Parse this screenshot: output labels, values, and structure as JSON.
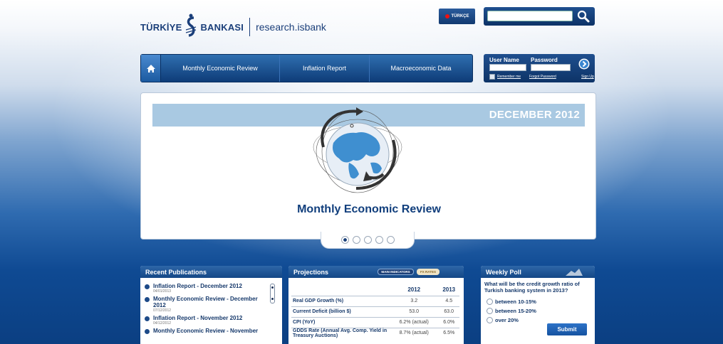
{
  "header": {
    "logo_left": "TÜRKİYE",
    "logo_right": "BANKASI",
    "logo_sub": "research.isbank",
    "lang_label": "TÜRKÇE",
    "search_placeholder": ""
  },
  "nav": {
    "items": [
      {
        "label": "Monthly Economic Review"
      },
      {
        "label": "Inflation Report"
      },
      {
        "label": "Macroeconomic Data"
      }
    ]
  },
  "login": {
    "user_label": "User Name",
    "password_label": "Password",
    "remember": "Remember me",
    "forgot": "Forgot Password",
    "signup": "Sign Up"
  },
  "slider": {
    "date": "DECEMBER 2012",
    "title": "Monthly Economic Review",
    "active_index": 0,
    "dot_count": 5
  },
  "publications": {
    "title": "Recent Publications",
    "items": [
      {
        "title": "Inflation Report - December 2012",
        "date": "04/01/2013"
      },
      {
        "title": "Monthly Economic Review - December 2012",
        "date": "07/12/2012"
      },
      {
        "title": "Inflation Report - November 2012",
        "date": "04/12/2012"
      },
      {
        "title": "Monthly Economic Review - November",
        "date": ""
      }
    ]
  },
  "projections": {
    "title": "Projections",
    "tab_main": "MAIN INDICATORS",
    "tab_rates": "FX RATES",
    "col1": "2012",
    "col2": "2013",
    "rows": [
      {
        "label": "Real GDP Growth (%)",
        "v2012": "3.2",
        "v2013": "4.5"
      },
      {
        "label": "Current Deficit (billion $)",
        "v2012": "53.0",
        "v2013": "63.0"
      },
      {
        "label": "CPI (YoY)",
        "v2012": "6.2% (actual)",
        "v2013": "6.0%"
      },
      {
        "label": "GDDS Rate (Annual Avg. Comp. Yield in Treasury Auctions)",
        "v2012": "8.7% (actual)",
        "v2013": "6.5%"
      }
    ]
  },
  "poll": {
    "title": "Weekly Poll",
    "question": "What will be the credit growth ratio of Turkish banking system in 2013?",
    "options": [
      "between 10-15%",
      "between 15-20%",
      "over 20%"
    ],
    "submit": "Submit"
  },
  "colors": {
    "brand_blue": "#103e7c",
    "nav_blue": "#1f5ca0",
    "band": "#a9c9e2"
  }
}
